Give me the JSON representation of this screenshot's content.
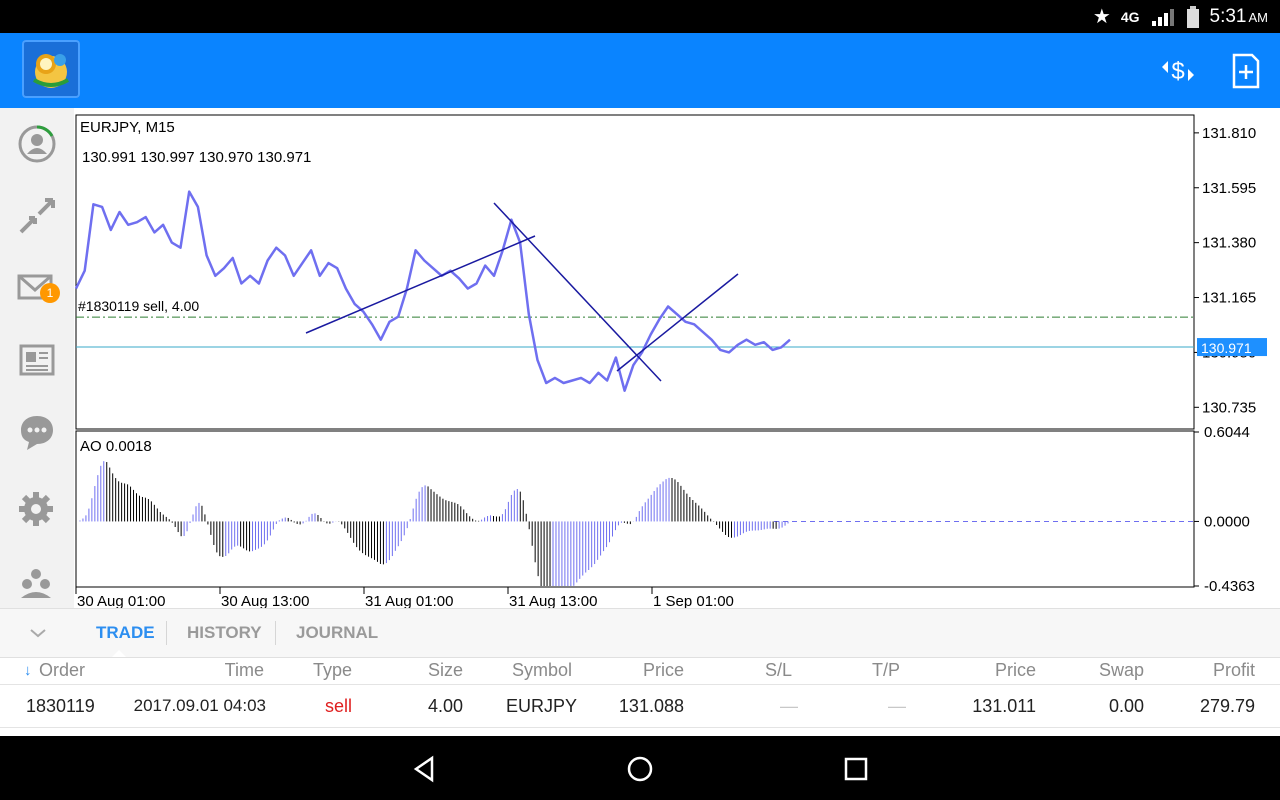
{
  "statusbar": {
    "network": "4G",
    "time": "5:31",
    "ampm": "AM"
  },
  "chart": {
    "symbol_label": "EURJPY, M15",
    "ohlc_label": "130.991 130.997 130.970 130.971",
    "order_line_label": "#1830119 sell, 4.00",
    "price_axis": [
      "131.810",
      "131.595",
      "131.380",
      "131.165",
      "130.950",
      "130.735"
    ],
    "current_price_tag": "130.971",
    "indicator_label": "AO 0.0018",
    "indicator_axis": [
      "0.6044",
      "0.0000",
      "-0.4363"
    ],
    "time_axis": [
      "30 Aug 01:00",
      "30 Aug 13:00",
      "31 Aug 01:00",
      "31 Aug 13:00",
      "1 Sep 01:00"
    ],
    "colors": {
      "line": "#6f6ff0",
      "trendline": "#1a1aa0",
      "order_line": "#2e7d32",
      "current_line": "#3aa8c8",
      "price_tag_bg": "#1e90ff"
    }
  },
  "chart_data": {
    "type": "line",
    "title": "EURJPY, M15",
    "xlabel": "",
    "ylabel": "",
    "x_ticks": [
      "30 Aug 01:00",
      "30 Aug 13:00",
      "31 Aug 01:00",
      "31 Aug 13:00",
      "1 Sep 01:00"
    ],
    "ylim": [
      130.65,
      131.88
    ],
    "series": [
      {
        "values": [
          131.2,
          131.27,
          131.53,
          131.52,
          131.43,
          131.5,
          131.45,
          131.46,
          131.48,
          131.42,
          131.45,
          131.38,
          131.36,
          131.58,
          131.52,
          131.33,
          131.25,
          131.28,
          131.32,
          131.22,
          131.25,
          131.22,
          131.31,
          131.36,
          131.33,
          131.25,
          131.3,
          131.35,
          131.25,
          131.3,
          131.28,
          131.2,
          131.14,
          131.11,
          131.06,
          131.0,
          131.07,
          131.09,
          131.2,
          131.35,
          131.31,
          131.28,
          131.25,
          131.27,
          131.24,
          131.2,
          131.22,
          131.29,
          131.25,
          131.35,
          131.47,
          131.38,
          131.1,
          130.92,
          130.83,
          130.85,
          130.83,
          130.84,
          130.85,
          130.83,
          130.87,
          130.84,
          130.93,
          130.8,
          130.9,
          130.95,
          131.02,
          131.08,
          131.13,
          131.1,
          131.07,
          131.06,
          131.03,
          131.0,
          130.96,
          130.95,
          130.98,
          131.0,
          130.98,
          130.99,
          130.96,
          130.97,
          131.0
        ]
      }
    ],
    "indicator": {
      "name": "AO",
      "last": 0.0018,
      "ylim": [
        -0.4363,
        0.6044
      ]
    }
  },
  "tabs": [
    {
      "label": "TRADE",
      "active": true
    },
    {
      "label": "HISTORY",
      "active": false
    },
    {
      "label": "JOURNAL",
      "active": false
    }
  ],
  "table": {
    "sort_arrow": "↓",
    "headers": [
      "Order",
      "Time",
      "Type",
      "Size",
      "Symbol",
      "Price",
      "S/L",
      "T/P",
      "Price",
      "Swap",
      "Profit"
    ],
    "row": [
      "1830119",
      "2017.09.01 04:03",
      "sell",
      "4.00",
      "EURJPY",
      "131.088",
      "—",
      "—",
      "131.011",
      "0.00",
      "279.79"
    ]
  },
  "sidebar": {
    "mail_badge": "1"
  },
  "icons": [
    "app-logo-icon",
    "currency-exchange-icon",
    "new-order-icon",
    "account-icon",
    "trade-icon",
    "mail-icon",
    "news-icon",
    "chat-icon",
    "settings-icon",
    "community-icon",
    "back-icon",
    "home-icon",
    "recents-icon"
  ]
}
